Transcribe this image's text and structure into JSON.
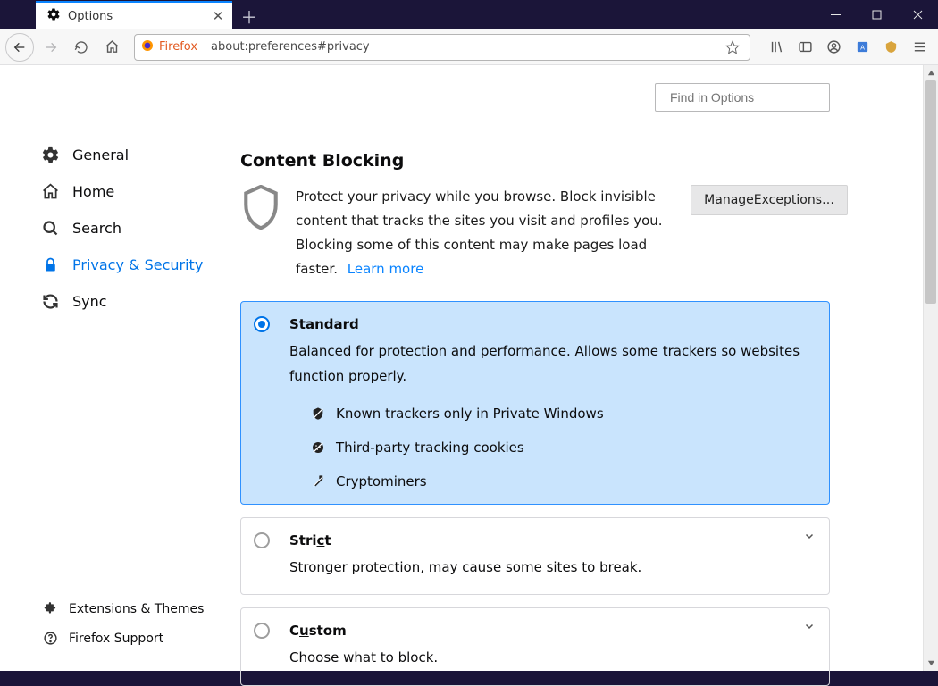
{
  "tab": {
    "title": "Options"
  },
  "urlbar": {
    "identity": "Firefox",
    "url": "about:preferences#privacy"
  },
  "search": {
    "placeholder": "Find in Options"
  },
  "sidebar": {
    "items": [
      {
        "label": "General"
      },
      {
        "label": "Home"
      },
      {
        "label": "Search"
      },
      {
        "label": "Privacy & Security"
      },
      {
        "label": "Sync"
      }
    ],
    "bottom": [
      {
        "label": "Extensions & Themes"
      },
      {
        "label": "Firefox Support"
      }
    ]
  },
  "content": {
    "section_title": "Content Blocking",
    "intro": "Protect your privacy while you browse. Block invisible content that tracks the sites you visit and profiles you. Blocking some of this content may make pages load faster.",
    "learn_more": "Learn more",
    "manage_exceptions": "Manage Exceptions…",
    "options": [
      {
        "name": "Standard",
        "desc": "Balanced for protection and performance. Allows some trackers so websites function properly.",
        "bullets": [
          "Known trackers only in Private Windows",
          "Third-party tracking cookies",
          "Cryptominers"
        ],
        "selected": true
      },
      {
        "name": "Strict",
        "desc": "Stronger protection, may cause some sites to break.",
        "selected": false
      },
      {
        "name": "Custom",
        "desc": "Choose what to block.",
        "selected": false
      }
    ]
  }
}
